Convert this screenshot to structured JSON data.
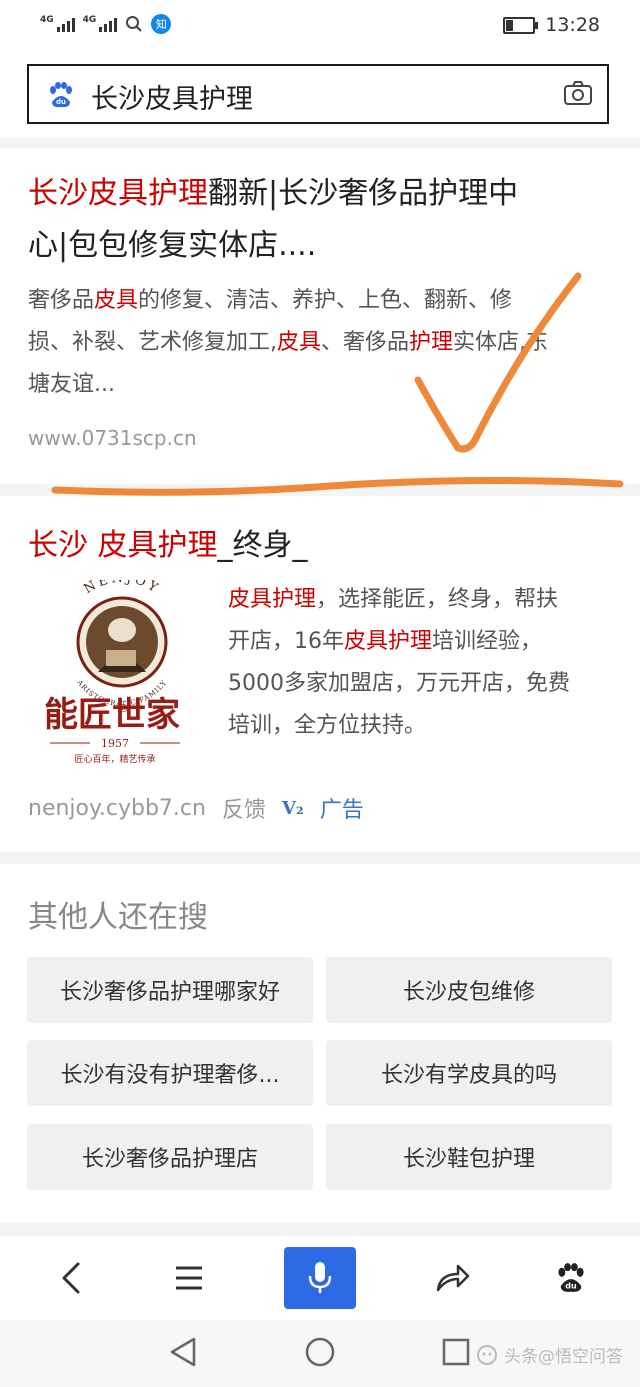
{
  "status": {
    "net1": "4G",
    "net2": "4G",
    "app_badge": "知",
    "time": "13:28",
    "battery_level": 0.25
  },
  "search": {
    "query": "长沙皮具护理"
  },
  "result1": {
    "title_line1_hl": "长沙皮具护理",
    "title_line1_rest": "翻新|长沙奢侈品护理中",
    "title_line2": "心|包包修复实体店....",
    "snippet_l1_a": "奢侈品",
    "snippet_l1_hl": "皮具",
    "snippet_l1_b": "的修复、清洁、养护、上色、翻新、修",
    "snippet_l2_a": "损、补裂、艺术修复加工,",
    "snippet_l2_hl1": "皮具",
    "snippet_l2_b": "、奢侈品",
    "snippet_l2_hl2": "护理",
    "snippet_l2_c": "实体店,东",
    "snippet_l3": "塘友谊...",
    "url": "www.0731scp.cn"
  },
  "result2": {
    "title_hl": "长沙 皮具护理",
    "title_rest": "_终身_",
    "logo_brand": "NENJOY",
    "logo_tagline": "ARISTOCRATIC FAMILY",
    "logo_name": "能匠世家",
    "logo_reg": "®",
    "logo_year": "1957",
    "logo_slogan": "匠心百年，精艺传承",
    "desc_l1_hl": "皮具护理",
    "desc_l1_rest": "，选择能匠，终身，帮扶",
    "desc_l2_a": "开店，16年",
    "desc_l2_hl": "皮具护理",
    "desc_l2_b": "培训经验，",
    "desc_l3": "5000多家加盟店，万元开店，免费",
    "desc_l4": "培训，全方位扶持。",
    "url": "nenjoy.cybb7.cn",
    "feedback": "反馈",
    "v_badge": "V₂",
    "ad_label": "广告"
  },
  "related": {
    "heading": "其他人还在搜",
    "items": [
      "长沙奢侈品护理哪家好",
      "长沙皮包维修",
      "长沙有没有护理奢侈...",
      "长沙有学皮具的吗",
      "长沙奢侈品护理店",
      "长沙鞋包护理"
    ]
  },
  "watermark": "头条@悟空问答",
  "colors": {
    "highlight_red": "#cc0000",
    "brand_blue": "#2d6ae3",
    "annotation_orange": "#f0883a",
    "link_blue": "#3a75c4"
  }
}
